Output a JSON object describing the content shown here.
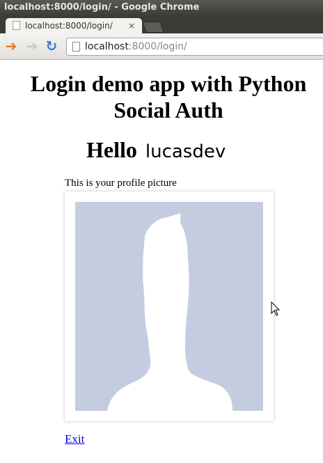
{
  "window": {
    "title": "localhost:8000/login/ - Google Chrome"
  },
  "tabs": [
    {
      "label": "localhost:8000/login/",
      "close": "×"
    }
  ],
  "toolbar": {
    "url_host": "localhost",
    "url_rest": ":8000/login/"
  },
  "page": {
    "heading": "Login demo app with Python Social Auth",
    "hello": "Hello",
    "username": "lucasdev",
    "caption": "This is your profile picture",
    "exit_label": "Exit"
  },
  "colors": {
    "picture_bg": "#c4cde0",
    "link": "#0000ee"
  },
  "icons": [
    "back-arrow-icon",
    "forward-arrow-icon",
    "reload-icon",
    "page-icon",
    "default-avatar-icon",
    "mouse-cursor-icon"
  ]
}
